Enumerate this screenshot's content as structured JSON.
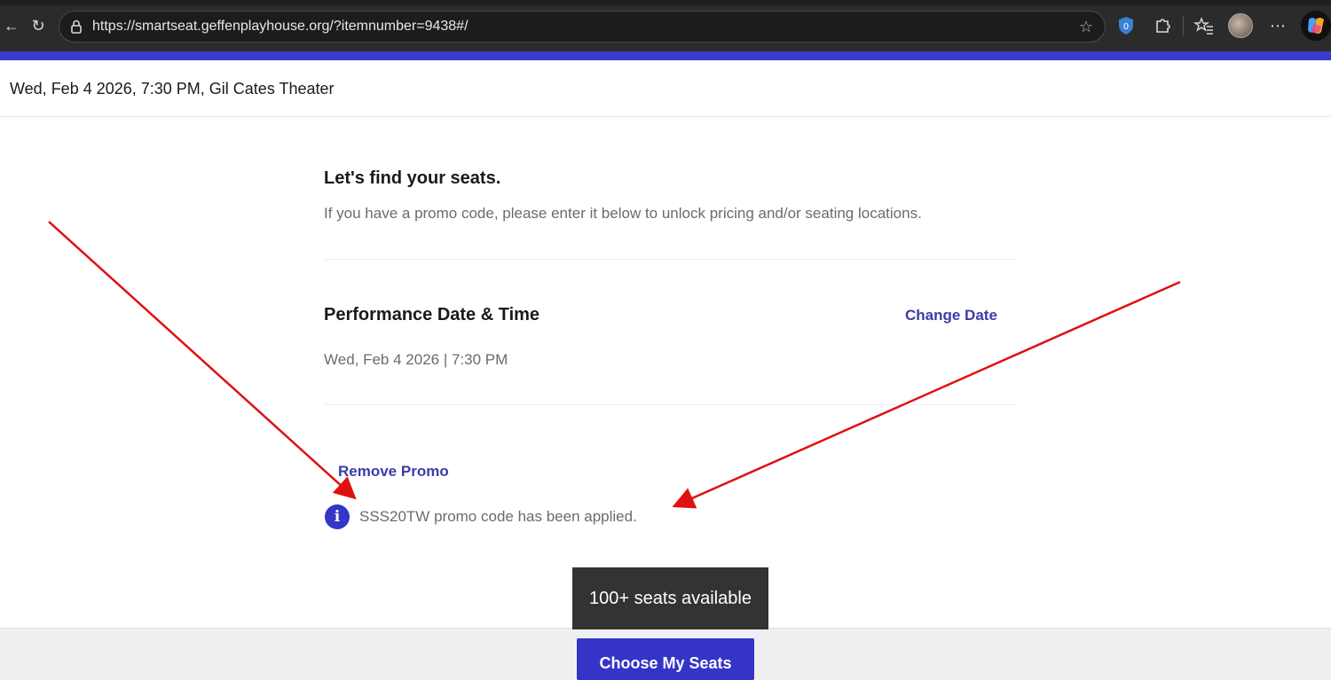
{
  "browser": {
    "url": "https://smartseat.geffenplayhouse.org/?itemnumber=9438#/",
    "icons": {
      "back": "arrow-left-icon",
      "reload": "reload-icon",
      "lock": "lock-icon",
      "favorite": "star-icon",
      "shield": "shield-extension-icon",
      "extensions": "puzzle-icon",
      "favorites": "favorites-icon",
      "profile": "avatar",
      "menu": "more-horizontal-icon",
      "copilot": "copilot-icon"
    }
  },
  "colors": {
    "accent": "#3a3acb",
    "link": "#3c3ca8",
    "cta": "#3434c8",
    "annotation": "#e01010"
  },
  "header": {
    "event_info": "Wed, Feb 4 2026, 7:30 PM, Gil Cates Theater"
  },
  "intro": {
    "title": "Let's find your seats.",
    "subtitle": "If you have a promo code, please enter it below to unlock pricing and/or seating locations."
  },
  "performance": {
    "title": "Performance Date & Time",
    "change_label": "Change Date",
    "value": "Wed, Feb 4 2026 | 7:30 PM"
  },
  "promo": {
    "remove_label": "Remove Promo",
    "info_icon": "info-icon",
    "message": "SSS20TW promo code has been applied."
  },
  "availability": {
    "tooltip": "100+ seats available"
  },
  "footer": {
    "cta_label": "Choose My Seats"
  }
}
